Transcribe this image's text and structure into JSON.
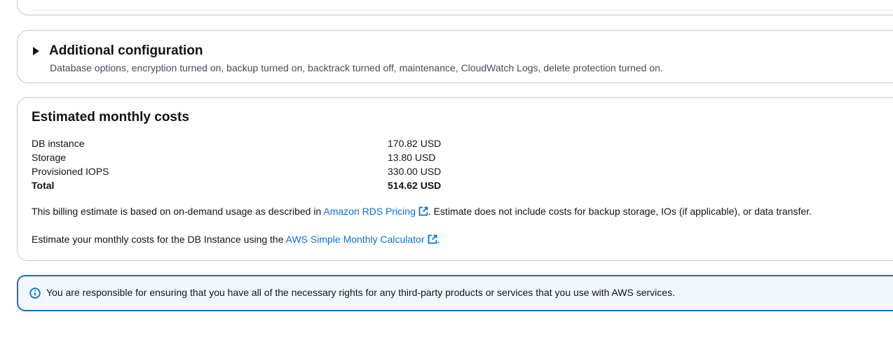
{
  "additional_config": {
    "title": "Additional configuration",
    "description": "Database options, encryption turned on, backup turned on, backtrack turned off, maintenance, CloudWatch Logs, delete protection turned on."
  },
  "costs": {
    "title": "Estimated monthly costs",
    "rows": [
      {
        "label": "DB instance",
        "value": "170.82 USD"
      },
      {
        "label": "Storage",
        "value": "13.80 USD"
      },
      {
        "label": "Provisioned IOPS",
        "value": "330.00 USD"
      },
      {
        "label": "Total",
        "value": "514.62 USD"
      }
    ],
    "billing_prefix": "This billing estimate is based on on-demand usage as described in ",
    "billing_link": "Amazon RDS Pricing",
    "billing_suffix": ". Estimate does not include costs for backup storage, IOs (if applicable), or data transfer.",
    "calc_prefix": "Estimate your monthly costs for the DB Instance using the ",
    "calc_link": "AWS Simple Monthly Calculator",
    "calc_suffix": "."
  },
  "alert": {
    "text": "You are responsible for ensuring that you have all of the necessary rights for any third-party products or services that you use with AWS services."
  },
  "colors": {
    "link": "#0972d3",
    "alert_border": "#0972d3",
    "alert_bg": "#f2f8fd"
  },
  "icons": [
    "caret-right-icon",
    "external-link-icon",
    "info-icon"
  ]
}
